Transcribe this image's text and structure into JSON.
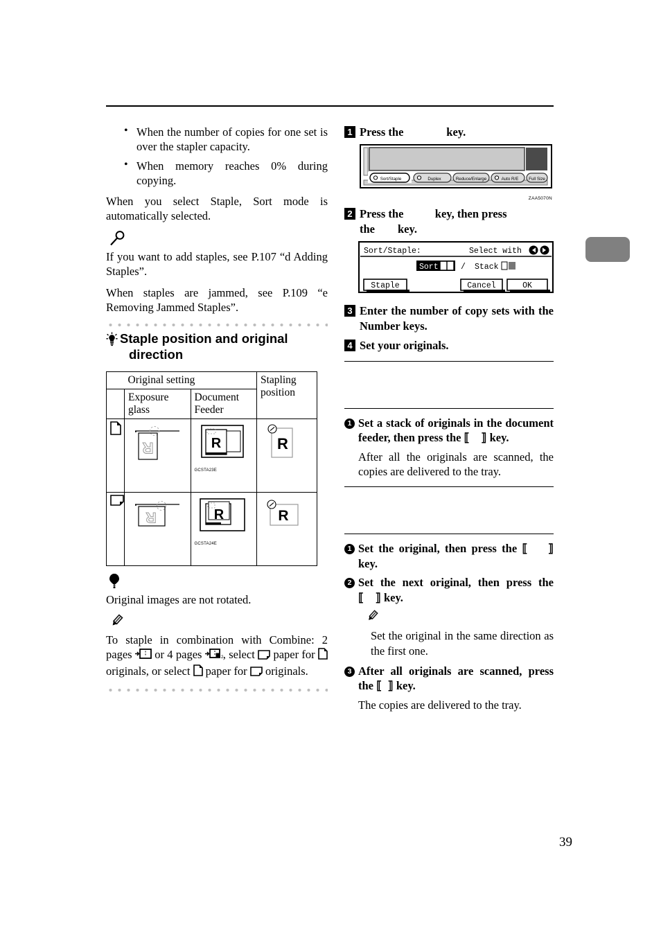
{
  "page": {
    "number": "39"
  },
  "left_column": {
    "bullets": [
      "When the number of copies for one set is over the stapler capacity.",
      "When memory reaches 0% during copying."
    ],
    "note_para": "When you select Staple, Sort mode is automatically selected.",
    "reference_icon": "magnifier-icon",
    "references": [
      "If you want to add staples, see P.107 “d Adding Staples”.",
      "When staples are jammed, see P.109 “e Removing Jammed Staples”."
    ],
    "section": {
      "icon": "lightbulb-icon",
      "title_line1": "Staple position and original",
      "title_line2": "direction"
    },
    "table": {
      "header_group": "Original setting",
      "header_staple": "Stapling position",
      "header_glass": "Exposure glass",
      "header_feeder": "Document Feeder",
      "rows": [
        {
          "orientation_icon": "page-portrait-icon",
          "glass_figure": "original-on-exposure-glass-portrait",
          "feeder_figure": "original-in-document-feeder-portrait",
          "feeder_caption": "GCSTA23E",
          "staple_figure": "staple-top-left-portrait",
          "staple_letter": "R"
        },
        {
          "orientation_icon": "page-landscape-icon",
          "glass_figure": "original-on-exposure-glass-landscape",
          "feeder_figure": "original-in-document-feeder-landscape",
          "feeder_caption": "GCSTA24E",
          "staple_figure": "staple-top-left-landscape",
          "staple_letter": "R"
        }
      ]
    },
    "limit_icon": "balloon-icon",
    "limit_text": "Original images are not rotated.",
    "note_icon": "pencil-icon",
    "combine_note": {
      "p1": "To staple in combination with Combine: 2 pages",
      "p2": "or 4 pages",
      "p3": ", select",
      "p4": "paper for",
      "p5": "originals, or select",
      "p6": "paper for",
      "p7": "originals."
    }
  },
  "right_column": {
    "step1": {
      "number": "1",
      "text_before": "Press the",
      "text_after": "key.",
      "figure_code": "ZAA5070N",
      "panel_buttons": [
        {
          "label": "Sort/Staple",
          "has_led": true,
          "selected": true
        },
        {
          "label": "Duplex",
          "has_led": true,
          "selected": false
        },
        {
          "label": "Reduce/Enlarge",
          "has_led": false,
          "selected": false
        },
        {
          "label": "Auto R/E",
          "has_led": true,
          "selected": false
        },
        {
          "label": "Full Size",
          "has_led": false,
          "selected": false
        }
      ]
    },
    "step2": {
      "number": "2",
      "line1_a": "Press the",
      "line1_b": "key, then press",
      "line2_a": "the",
      "line2_b": "key.",
      "lcd": {
        "title": "Sort/Staple:",
        "hint": "Select with",
        "arrow_left_icon": "arrow-left-icon",
        "arrow_right_icon": "arrow-right-icon",
        "option_sort": "Sort",
        "separator": "/",
        "option_stack": "Stack",
        "btn_staple": "Staple",
        "btn_cancel": "Cancel",
        "btn_ok": "OK"
      }
    },
    "step3": {
      "number": "3",
      "text": "Enter the number of copy sets with the Number keys."
    },
    "step4": {
      "number": "4",
      "text": "Set your originals."
    },
    "group_a": {
      "items": [
        {
          "number": "1",
          "text_a": "Set a stack of originals in the document feeder, then press the",
          "text_b": "key.",
          "body": "After all the originals are scanned, the copies are delivered to the tray."
        }
      ]
    },
    "group_b": {
      "items": [
        {
          "number": "1",
          "text_a": "Set the original, then press the",
          "text_b": "key."
        },
        {
          "number": "2",
          "text_a": "Set the next original, then press the",
          "text_b": "key."
        }
      ],
      "note_icon": "pencil-icon",
      "note_text": "Set the original in the same direction as the first one.",
      "item3": {
        "number": "3",
        "text_a": "After all originals are scanned, press the",
        "text_b": "key.",
        "body": "The copies are delivered to the tray."
      }
    }
  }
}
